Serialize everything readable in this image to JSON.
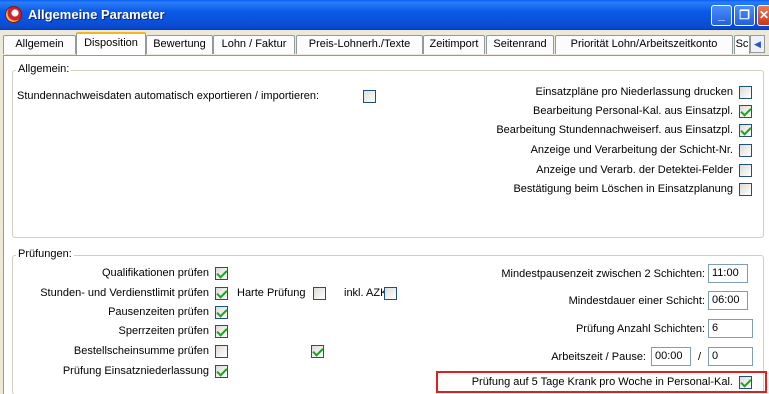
{
  "window": {
    "title": "Allgemeine Parameter",
    "minimize_icon": "minimize-icon",
    "maximize_icon": "restore-icon",
    "close_icon": "close-icon"
  },
  "tabs": [
    {
      "label": "Allgemein"
    },
    {
      "label": "Disposition"
    },
    {
      "label": "Bewertung"
    },
    {
      "label": "Lohn / Faktur"
    },
    {
      "label": "Preis-Lohnerh./Texte"
    },
    {
      "label": "Zeitimport"
    },
    {
      "label": "Seitenrand"
    },
    {
      "label": "Priorität Lohn/Arbeitszeitkonto"
    },
    {
      "label": "Sc"
    }
  ],
  "active_tab": "Disposition",
  "allgemein": {
    "legend": "Allgemein:",
    "export_label": "Stundennachweisdaten automatisch exportieren / importieren:",
    "export_checked": false,
    "right_items": [
      {
        "label": "Einsatzpläne pro Niederlassung drucken",
        "checked": false
      },
      {
        "label": "Bearbeitung Personal-Kal. aus Einsatzpl.",
        "checked": true
      },
      {
        "label": "Bearbeitung Stundennachweiserf. aus Einsatzpl.",
        "checked": true
      },
      {
        "label": "Anzeige und Verarbeitung der Schicht-Nr.",
        "checked": false
      },
      {
        "label": "Anzeige und Verarb. der Detektei-Felder",
        "checked": false
      },
      {
        "label": "Bestätigung beim Löschen in Einsatzplanung",
        "checked": false
      }
    ]
  },
  "pruefungen": {
    "legend": "Prüfungen:",
    "left_items": [
      {
        "label": "Qualifikationen prüfen",
        "checked": true
      },
      {
        "label": "Stunden- und Verdienstlimit prüfen",
        "checked": true
      },
      {
        "label": "Pausenzeiten prüfen",
        "checked": true
      },
      {
        "label": "Sperrzeiten prüfen",
        "checked": true
      },
      {
        "label": "Bestellscheinsumme prüfen",
        "checked": false
      },
      {
        "label": "Prüfung Einsatzniederlassung",
        "checked": true
      }
    ],
    "harte_pruefung": {
      "label": "Harte Prüfung",
      "checked": false
    },
    "inkl_azk": {
      "label": "inkl. AZK",
      "checked": false
    },
    "extra_checkbox_checked": true,
    "mindestpause": {
      "label": "Mindestpausenzeit zwischen 2 Schichten:",
      "value": "11:00"
    },
    "mindestdauer": {
      "label": "Mindestdauer einer Schicht:",
      "value": "06:00"
    },
    "anzahl_schichten": {
      "label": "Prüfung Anzahl Schichten:",
      "value": "6"
    },
    "arbeitszeit_pause": {
      "label": "Arbeitszeit / Pause:",
      "value1": "00:00",
      "separator": "/",
      "value2": "0"
    },
    "krank": {
      "label": "Prüfung auf 5 Tage Krank pro Woche in Personal-Kal.",
      "checked": true
    }
  }
}
